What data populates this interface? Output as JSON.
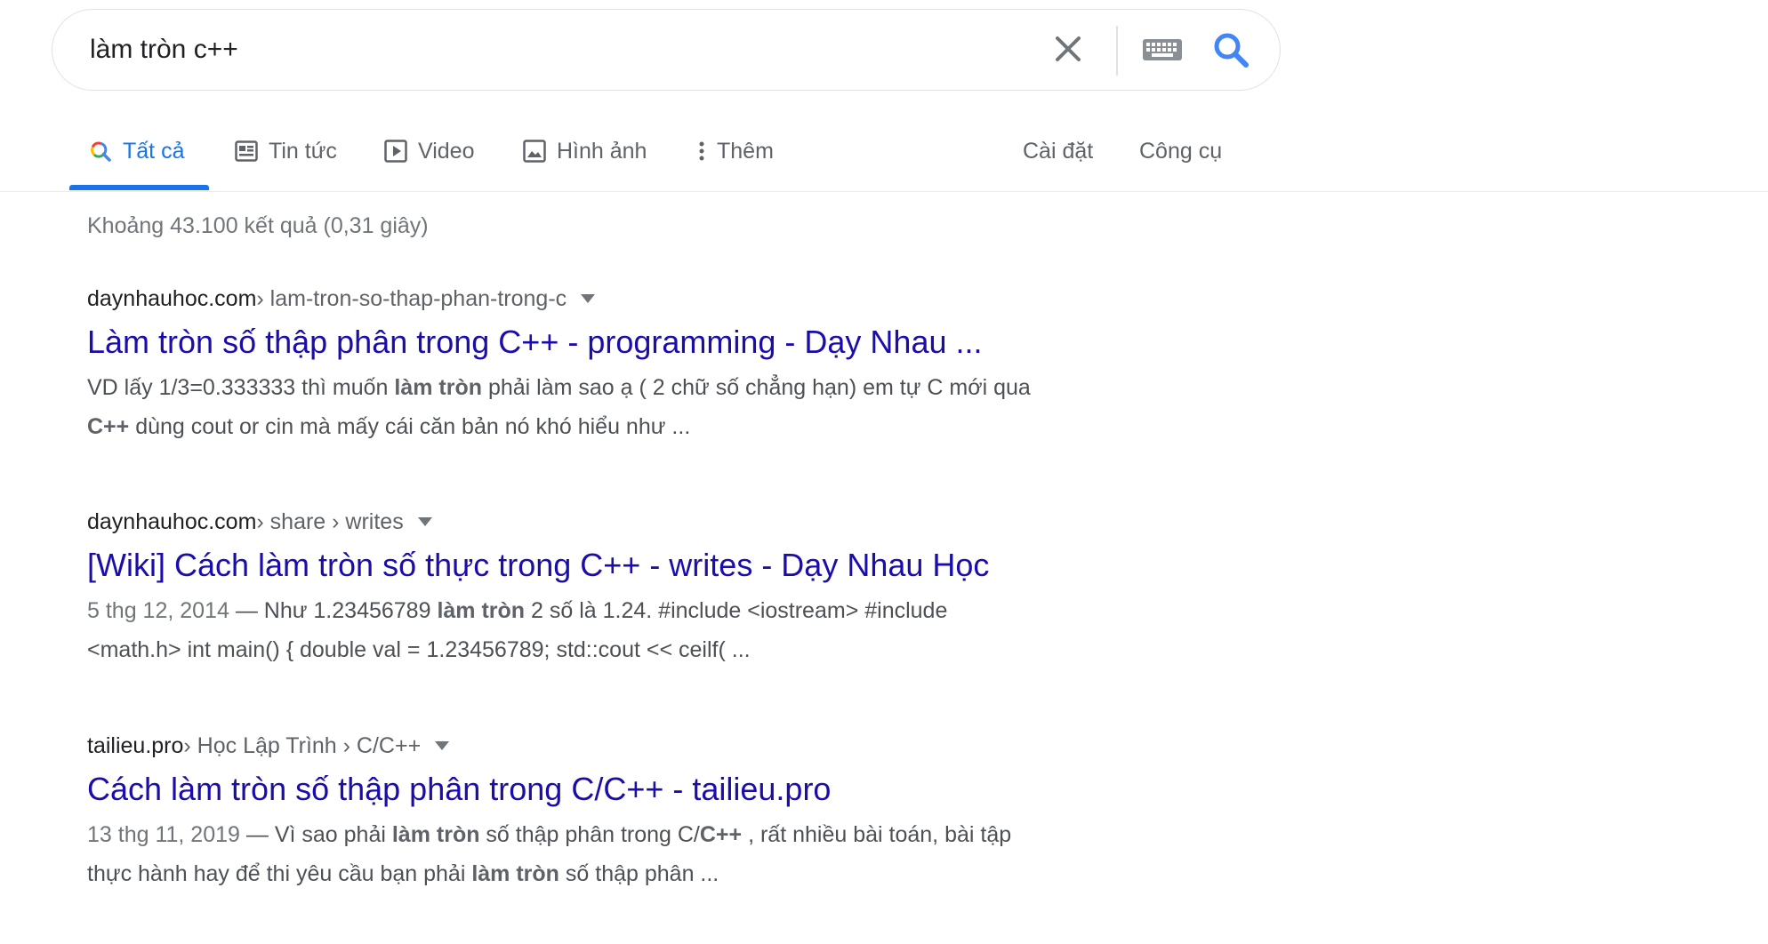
{
  "search": {
    "query": "làm tròn c++"
  },
  "tabs": [
    {
      "label": "Tất cả",
      "icon": "search-icon",
      "active": true
    },
    {
      "label": "Tin tức",
      "icon": "news-icon"
    },
    {
      "label": "Video",
      "icon": "video-icon"
    },
    {
      "label": "Hình ảnh",
      "icon": "image-icon"
    },
    {
      "label": "Thêm",
      "icon": "more-vert-icon"
    }
  ],
  "tools": {
    "settings": "Cài đặt",
    "tools": "Công cụ"
  },
  "stats": "Khoảng 43.100 kết quả (0,31 giây)",
  "results": [
    {
      "domain": "daynhauhoc.com",
      "path": " › lam-tron-so-thap-phan-trong-c",
      "title": "Làm tròn số thập phân trong C++ - programming - Dạy Nhau ...",
      "snippet_line1": {
        "a": "VD lấy 1/3=0.333333 thì muốn ",
        "b": "làm tròn",
        "c": " phải làm sao ạ ( 2 chữ số chẳng hạn) em tự C mới qua"
      },
      "snippet_line2": {
        "a": "C++",
        "b": " dùng cout or cin mà mấy cái căn bản nó khó hiểu như ..."
      }
    },
    {
      "domain": "daynhauhoc.com",
      "path": " › share › writes",
      "title": "[Wiki] Cách làm tròn số thực trong C++ - writes - Dạy Nhau Học",
      "date": "5 thg 12, 2014",
      "snippet_line1": {
        "a": " — Như 1.23456789 ",
        "b": "làm tròn",
        "c": " 2 số là 1.24. #include <iostream> #include"
      },
      "snippet_line2": "<math.h> int main() { double val = 1.23456789; std::cout << ceilf( ..."
    },
    {
      "domain": "tailieu.pro",
      "path": " › Học Lập Trình › C/C++",
      "title": "Cách làm tròn số thập phân trong C/C++ - tailieu.pro",
      "date": "13 thg 11, 2019",
      "snippet_line1": {
        "a": " — Vì sao phải ",
        "b": "làm tròn",
        "c": " số thập phân trong C/",
        "d": "C++",
        "e": " , rất nhiều bài toán, bài tập"
      },
      "snippet_line2": {
        "a": "thực hành hay để thi yêu cầu bạn phải ",
        "b": "làm tròn",
        "c": " số thập phân ..."
      }
    }
  ],
  "colors": {
    "link": "#1a0dab",
    "accent": "#1a73e8",
    "muted": "#70757a"
  }
}
